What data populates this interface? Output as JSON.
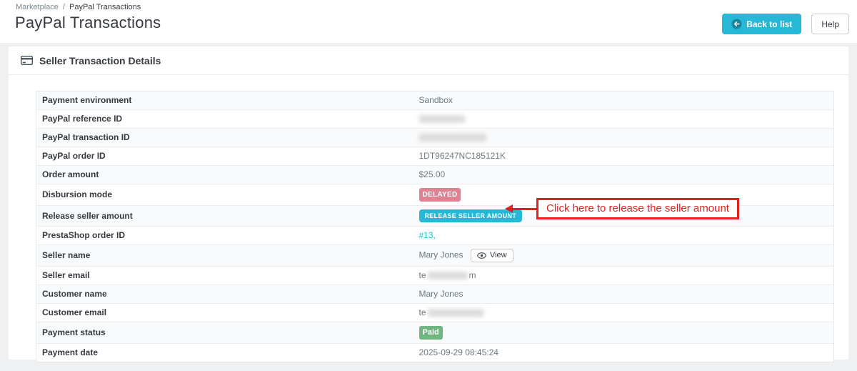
{
  "colors": {
    "accent_teal": "#25b9d7",
    "badge_danger_bg": "#df8291",
    "badge_success_bg": "#6fb681",
    "annotation_red": "#e0211f",
    "label_text": "#363a41",
    "value_text": "#6c7a84"
  },
  "breadcrumb": {
    "parent": "Marketplace",
    "separator": "/",
    "current": "PayPal Transactions"
  },
  "page_title": "PayPal Transactions",
  "actions": {
    "back_to_list": "Back to list",
    "help": "Help"
  },
  "panel": {
    "title": "Seller Transaction Details"
  },
  "table": {
    "rows": [
      {
        "label": "Payment environment",
        "value": "Sandbox"
      },
      {
        "label": "PayPal reference ID",
        "redacted": true
      },
      {
        "label": "PayPal transaction ID",
        "redacted": true
      },
      {
        "label": "PayPal order ID",
        "value": "1DT96247NC185121K"
      },
      {
        "label": "Order amount",
        "value": "$25.00"
      },
      {
        "label": "Disbursion mode",
        "badge": "DELAYED"
      },
      {
        "label": "Release seller amount",
        "button": "RELEASE SELLER AMOUNT"
      },
      {
        "label": "PrestaShop order ID",
        "link": "#13",
        "after": ","
      },
      {
        "label": "Seller name",
        "value": "Mary Jones",
        "view_button": "View"
      },
      {
        "label": "Seller email",
        "prefix": "te",
        "suffix": "m",
        "redacted": true
      },
      {
        "label": "Customer name",
        "value": "Mary Jones"
      },
      {
        "label": "Customer email",
        "prefix": "te",
        "redacted": true
      },
      {
        "label": "Payment status",
        "badge": "Paid"
      },
      {
        "label": "Payment date",
        "value": "2025-09-29 08:45:24"
      }
    ]
  },
  "annotation": {
    "text": "Click here to release the seller amount"
  }
}
